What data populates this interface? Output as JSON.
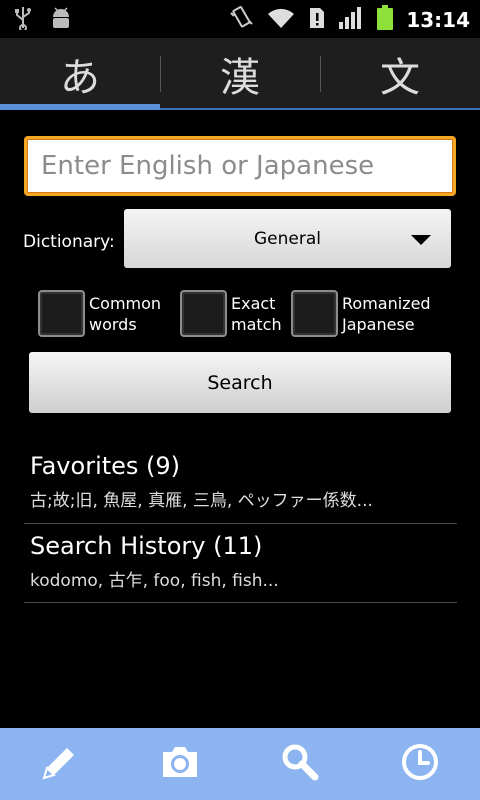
{
  "status_bar": {
    "time": "13:14",
    "icons": [
      "usb-icon",
      "android-debug-icon",
      "vibrate-icon",
      "wifi-icon",
      "sim-alert-icon",
      "signal-icon",
      "battery-icon"
    ]
  },
  "tabs": [
    {
      "label": "あ",
      "active": true
    },
    {
      "label": "漢",
      "active": false
    },
    {
      "label": "文",
      "active": false
    }
  ],
  "search": {
    "value": "",
    "placeholder": "Enter English or Japanese",
    "button_label": "Search"
  },
  "dictionary": {
    "label": "Dictionary:",
    "selected": "General"
  },
  "checkboxes": [
    {
      "line1": "Common",
      "line2": "words",
      "checked": false
    },
    {
      "line1": "Exact",
      "line2": "match",
      "checked": false
    },
    {
      "line1": "Romanized",
      "line2": "Japanese",
      "checked": false
    }
  ],
  "favorites": {
    "title": "Favorites (9)",
    "preview": "古;故;旧, 魚屋, 真雁, 三鳥, ペッファー係数..."
  },
  "history": {
    "title": "Search History (11)",
    "preview": "kodomo, 古乍, foo, fish, fish..."
  },
  "bottom_bar": [
    "pencil-icon",
    "camera-icon",
    "search-icon",
    "clock-icon"
  ],
  "colors": {
    "accent_tab": "#5b8fd8",
    "focus_border": "#f5a623",
    "bottom_bar": "#8bb4f0"
  }
}
